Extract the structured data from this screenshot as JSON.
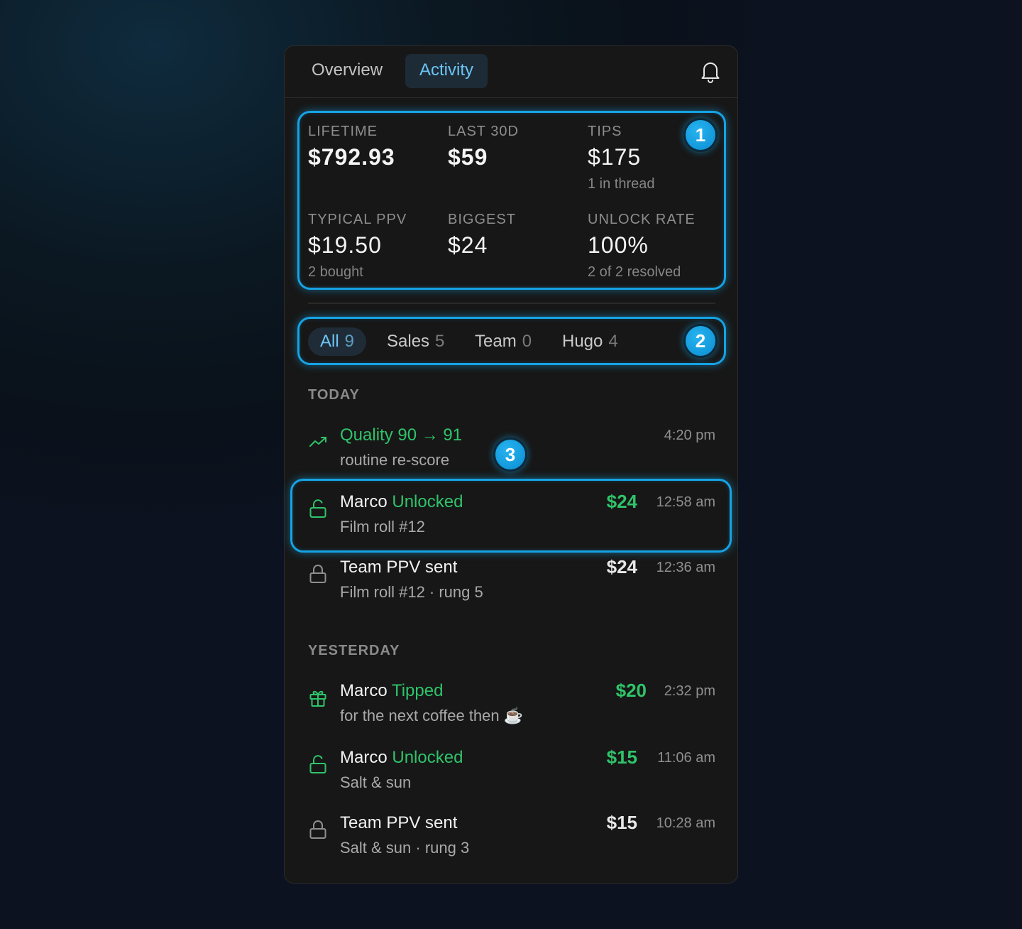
{
  "tabs": {
    "overview": "Overview",
    "activity": "Activity"
  },
  "stats": [
    {
      "label": "LIFETIME",
      "value": "$792.93",
      "sub": ""
    },
    {
      "label": "LAST 30D",
      "value": "$59",
      "sub": ""
    },
    {
      "label": "TIPS",
      "value": "$175",
      "sub": "1 in thread"
    },
    {
      "label": "TYPICAL PPV",
      "value": "$19.50",
      "sub": "2 bought"
    },
    {
      "label": "BIGGEST",
      "value": "$24",
      "sub": ""
    },
    {
      "label": "UNLOCK RATE",
      "value": "100%",
      "sub": "2 of 2 resolved"
    }
  ],
  "filters": [
    {
      "label": "All",
      "count": "9"
    },
    {
      "label": "Sales",
      "count": "5"
    },
    {
      "label": "Team",
      "count": "0"
    },
    {
      "label": "Hugo",
      "count": "4"
    }
  ],
  "sections": {
    "today": "TODAY",
    "yesterday": "YESTERDAY"
  },
  "events": [
    {
      "icon": "trending-up-icon",
      "title": "",
      "action": "Quality 90 → 91",
      "sub": "routine re-score",
      "amount": "",
      "time": "4:20 pm"
    },
    {
      "icon": "unlock-icon",
      "title": "Marco",
      "action": "Unlocked",
      "sub": "Film roll #12",
      "amount": "$24",
      "time": "12:58 am"
    },
    {
      "icon": "lock-icon",
      "title": "Team PPV sent",
      "action": "",
      "sub": "Film roll #12 · rung 5",
      "amount": "$24",
      "time": "12:36 am"
    },
    {
      "icon": "gift-icon",
      "title": "Marco",
      "action": "Tipped",
      "sub": "for the next coffee then ☕",
      "amount": "$20",
      "time": "2:32 pm"
    },
    {
      "icon": "unlock-icon",
      "title": "Marco",
      "action": "Unlocked",
      "sub": "Salt & sun",
      "amount": "$15",
      "time": "11:06 am"
    },
    {
      "icon": "lock-icon",
      "title": "Team PPV sent",
      "action": "",
      "sub": "Salt & sun · rung 3",
      "amount": "$15",
      "time": "10:28 am"
    }
  ],
  "badges": [
    "1",
    "2",
    "3"
  ],
  "colors": {
    "accent": "#6cc5f5",
    "highlight": "#16a3e4",
    "positive": "#2fc46a",
    "panel": "#171717"
  }
}
